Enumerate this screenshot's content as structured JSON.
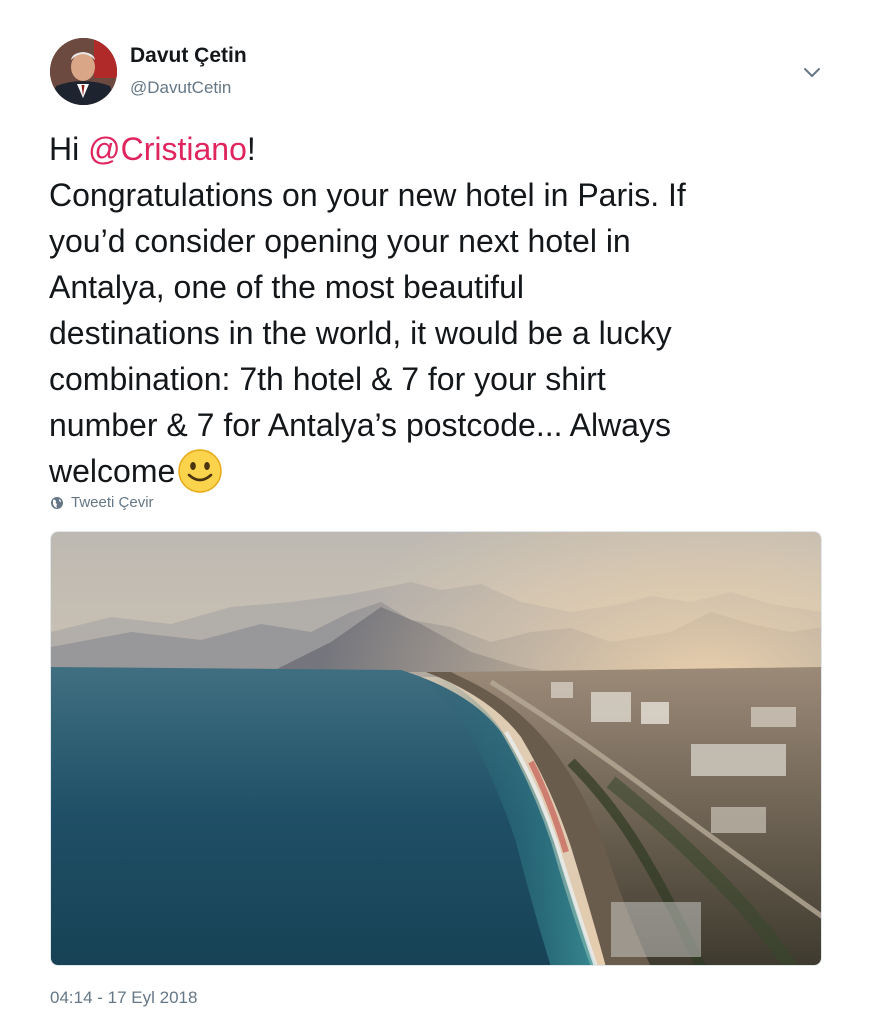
{
  "author": {
    "display_name": "Davut Çetin",
    "handle": "@DavutCetin",
    "avatar_icon": "avatar-photo"
  },
  "menu": {
    "icon": "chevron-down-icon"
  },
  "text": {
    "l1_greeting": "Hi ",
    "l1_mention": "@Cristiano",
    "l1_end": "!",
    "l2": "Congratulations on your new hotel in Paris. If",
    "l3": "you’d consider opening your next hotel in",
    "l4": "Antalya, one of the most beautiful",
    "l5": "destinations in the world, it would be a lucky",
    "l6": "combination: 7th hotel & 7 for your shirt",
    "l7": "number & 7 for Antalya’s postcode... Always",
    "l8": "welcome",
    "emoji": "slightly-smiling-face"
  },
  "translate": {
    "icon": "globe-icon",
    "label": "Tweeti Çevir"
  },
  "media": {
    "description_icon": "antalya-coast-photo"
  },
  "timestamp": "04:14 - 17 Eyl 2018",
  "colors": {
    "mention": "#e0245e",
    "secondary_text": "#657786",
    "primary_text": "#14171a"
  }
}
